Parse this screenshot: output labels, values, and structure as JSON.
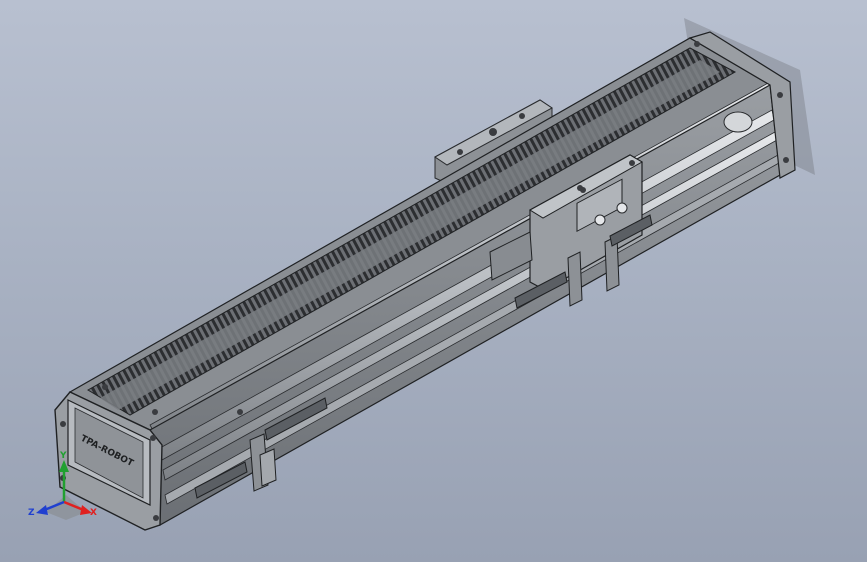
{
  "viewport": {
    "background_top": "#b8c0d0",
    "background_bottom": "#98a1b3"
  },
  "model": {
    "body_color": "#7f8388",
    "rail_color": "#c9ccd0",
    "cover_pattern": "#2c2e31",
    "brand_plate_text": "TPA-ROBOT"
  },
  "triad": {
    "x_label": "X",
    "y_label": "Y",
    "z_label": "Z",
    "x_color": "#e02020",
    "y_color": "#20a030",
    "z_color": "#2040d0"
  }
}
